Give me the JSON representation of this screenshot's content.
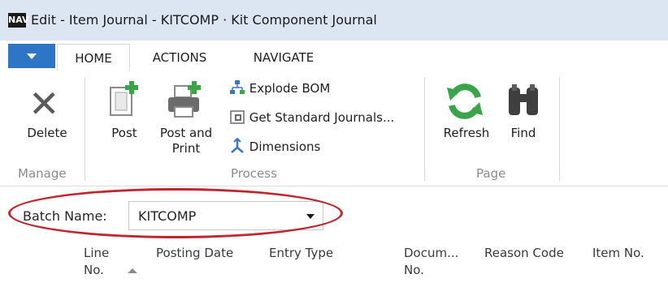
{
  "window": {
    "title": "Edit - Item Journal - KITCOMP · Kit Component Journal",
    "logo_text": "NAV"
  },
  "tabs": [
    {
      "label": "HOME",
      "active": true
    },
    {
      "label": "ACTIONS",
      "active": false
    },
    {
      "label": "NAVIGATE",
      "active": false
    }
  ],
  "ribbon": {
    "groups": [
      {
        "label": "Manage"
      },
      {
        "label": "Process"
      },
      {
        "label": "Page"
      }
    ],
    "delete_label": "Delete",
    "post_label": "Post",
    "post_print_label_line1": "Post and",
    "post_print_label_line2": "Print",
    "explode_bom_label": "Explode BOM",
    "get_standard_label": "Get Standard Journals...",
    "dimensions_label": "Dimensions",
    "refresh_label": "Refresh",
    "find_label": "Find"
  },
  "batch": {
    "label": "Batch Name:",
    "value": "KITCOMP"
  },
  "columns": {
    "line_no_1": "Line",
    "line_no_2": "No.",
    "posting_date": "Posting Date",
    "entry_type": "Entry Type",
    "document_no_1": "Docum...",
    "document_no_2": "No.",
    "reason_code": "Reason Code",
    "item_no": "Item No."
  },
  "colors": {
    "accent": "#2e75c6",
    "titlebar": "#dce6f2",
    "highlight_ring": "#c0262e",
    "green_icon": "#3aa548"
  },
  "icons": {
    "delete": "close-x-icon",
    "post": "post-document-icon",
    "post_print": "printer-icon",
    "explode_bom": "tree-icon",
    "get_standard": "journal-icon",
    "dimensions": "dimensions-icon",
    "refresh": "refresh-icon",
    "find": "binoculars-icon"
  }
}
